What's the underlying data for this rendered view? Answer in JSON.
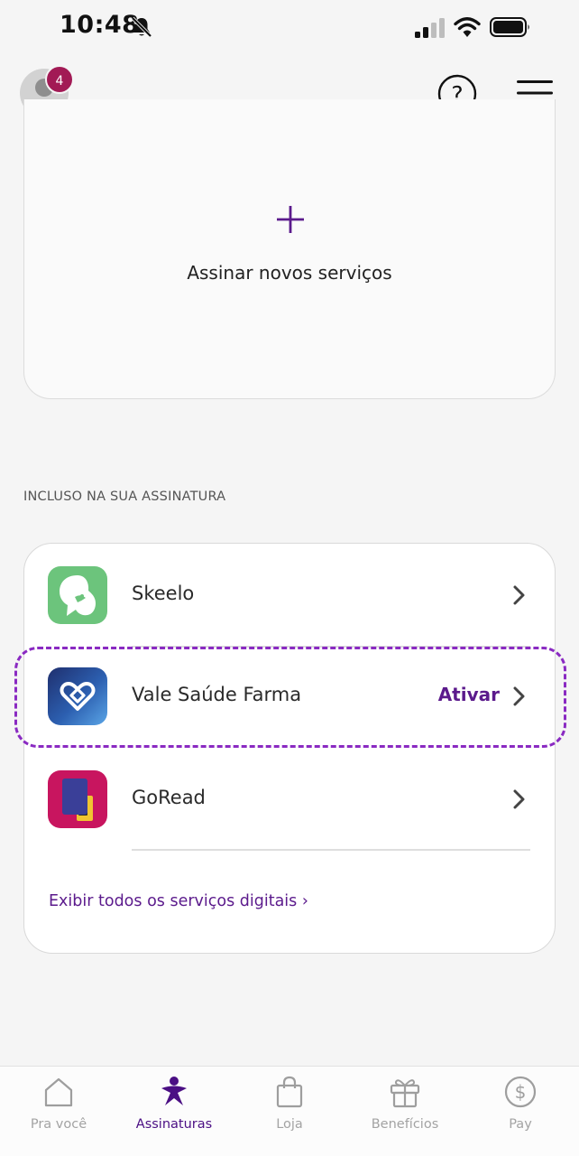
{
  "status_bar": {
    "time": "10:48"
  },
  "header": {
    "notification_count": "4"
  },
  "add_card": {
    "label": "Assinar novos serviços"
  },
  "included_section": {
    "title": "INCLUSO NA SUA ASSINATURA",
    "services": [
      {
        "name": "Skeelo",
        "action": "",
        "icon": "skeelo-app-icon"
      },
      {
        "name": "Vale Saúde Farma",
        "action": "Ativar",
        "icon": "vale-saude-farma-app-icon"
      },
      {
        "name": "GoRead",
        "action": "",
        "icon": "goread-app-icon"
      }
    ],
    "view_all_link": "Exibir todos os serviços digitais ›"
  },
  "tab_bar": {
    "tabs": [
      {
        "label": "Pra você",
        "icon": "home-icon",
        "active": false
      },
      {
        "label": "Assinaturas",
        "icon": "person-star-icon",
        "active": true
      },
      {
        "label": "Loja",
        "icon": "shopping-bag-icon",
        "active": false
      },
      {
        "label": "Benefícios",
        "icon": "gift-icon",
        "active": false
      },
      {
        "label": "Pay",
        "icon": "dollar-coin-icon",
        "active": false
      }
    ]
  },
  "colors": {
    "accent": "#5b1a8c",
    "highlight_border": "#8a2ac2",
    "badge": "#a21a55",
    "skeelo_green": "#6cc47c",
    "goread_pink": "#c8155f"
  }
}
